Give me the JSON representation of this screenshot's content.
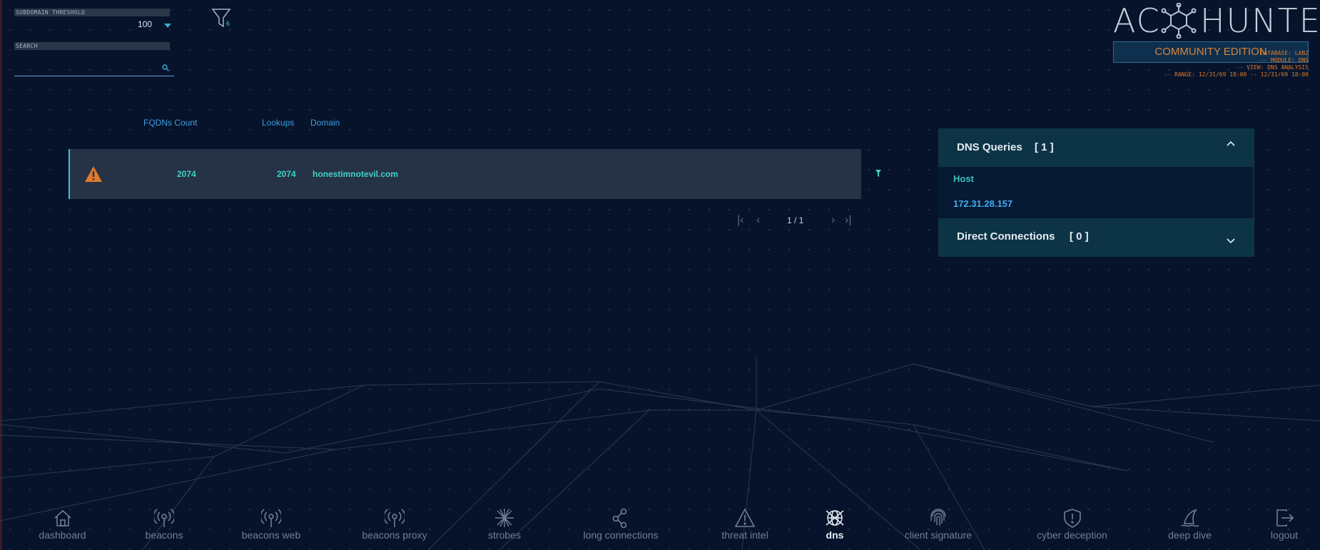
{
  "filters": {
    "threshold_label": "SUBDOMAIN THRESHOLD",
    "threshold_value": "100",
    "search_label": "SEARCH",
    "search_value": "",
    "filter_count": "6"
  },
  "brand": {
    "logo_left": "AC",
    "logo_right": "HUNTER",
    "edition": "COMMUNITY EDITION",
    "meta": [
      "DATABASE: LAB2",
      "-- MODULE: DNS",
      "-- VIEW: DNS ANALYSIS",
      "-- RANGE: 12/31/69 18:00 -- 12/31/69 18:00"
    ]
  },
  "table": {
    "columns": [
      "FQDNs Count",
      "Lookups",
      "Domain"
    ],
    "rows": [
      {
        "fqdns": "2074",
        "lookups": "2074",
        "domain": "honestimnotevil.com"
      }
    ],
    "pagination": "1 / 1"
  },
  "panel": {
    "dns_title": "DNS Queries",
    "dns_count": "[ 1 ]",
    "host_label": "Host",
    "host_value": "172.31.28.157",
    "direct_title": "Direct Connections",
    "direct_count": "[ 0 ]"
  },
  "nav": [
    {
      "label": "dashboard",
      "icon": "home-icon"
    },
    {
      "label": "beacons",
      "icon": "antenna-icon"
    },
    {
      "label": "beacons web",
      "icon": "antenna-icon"
    },
    {
      "label": "beacons proxy",
      "icon": "antenna-icon"
    },
    {
      "label": "strobes",
      "icon": "starburst-icon"
    },
    {
      "label": "long connections",
      "icon": "nodes-icon"
    },
    {
      "label": "threat intel",
      "icon": "warning-icon"
    },
    {
      "label": "dns",
      "icon": "globe-icon",
      "active": true
    },
    {
      "label": "client signature",
      "icon": "fingerprint-icon"
    },
    {
      "label": "cyber deception",
      "icon": "shield-icon"
    },
    {
      "label": "deep dive",
      "icon": "shark-fin-icon"
    },
    {
      "label": "logout",
      "icon": "logout-icon"
    }
  ],
  "colors": {
    "accent": "#3fd3c9",
    "warning": "#e07a2c",
    "background": "#07132b"
  }
}
